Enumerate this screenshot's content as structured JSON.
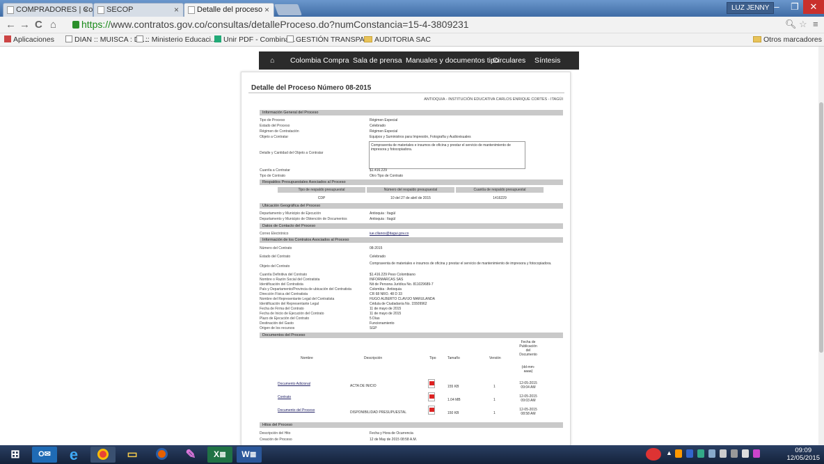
{
  "browser": {
    "tabs": [
      {
        "label": "COMPRADORES | Colomb"
      },
      {
        "label": "SECOP"
      },
      {
        "label": "Detalle del proceso"
      }
    ],
    "user_badge": "LUZ JENNY",
    "url_https": "https://",
    "url_rest": "www.contratos.gov.co/consultas/detalleProceso.do?numConstancia=15-4-3809231",
    "bookmarks": [
      "Aplicaciones",
      "DIAN :: MUISCA : Dil...",
      ":: Ministerio Educaci...",
      "Unir PDF - Combina...",
      "GESTIÓN TRANSPA...",
      "AUDITORIA SAC"
    ],
    "other_bookmarks": "Otros marcadores"
  },
  "site_nav": [
    "Colombia Compra",
    "Sala de prensa",
    "Manuales y documentos tipo",
    "Circulares",
    "Síntesis"
  ],
  "panel": {
    "title": "Detalle del Proceso Número 08-2015",
    "entity": "ANTIOQUIA - INSTITUCIÓN EDUCATIVA CARLOS ENRIQUE CORTES - ITAGÜI",
    "sections": {
      "general": "Información General del Proceso",
      "budget": "Respaldos Presupuestales Asociados al Proceso",
      "location": "Ubicación Geográfica del Proceso",
      "contact": "Datos de Contacto del Proceso",
      "contracts": "Información de los Contratos Asociados al Proceso",
      "documents": "Documentos del Proceso",
      "milestones": "Hitos del Proceso"
    },
    "general_rows": [
      {
        "label": "Tipo de Proceso",
        "value": "Régimen Especial"
      },
      {
        "label": "Estado del Proceso",
        "value": "Celebrado"
      },
      {
        "label": "Régimen de Contratación",
        "value": "Régimen Especial"
      },
      {
        "label": "Objeto a Contratar",
        "value": "Equipos y Suministros para Impresión, Fotografía y Audiovisuales"
      },
      {
        "label": "Detalle y Cantidad del Objeto a Contratar",
        "value": ""
      },
      {
        "label": "Cuantía a Contratar",
        "value": "$1.416.229"
      },
      {
        "label": "Tipo de Contrato",
        "value": "Otro Tipo de Contrato"
      }
    ],
    "detail_text": "Compraventa de materiales e insumos de oficina y prestar el servicio de mantenimiento de impresora y fotocopiadora.",
    "budget_headers": [
      "Tipo de respaldo presupuestal",
      "Número del respaldo presupuestal",
      "Cuantía de respaldo presupuestal"
    ],
    "budget_row": [
      "CDP",
      "10 del 27 de abril de 2015",
      "1416229"
    ],
    "location_rows": [
      {
        "label": "Departamento y Municipio de Ejecución",
        "value": "Antioquia : Itagüí"
      },
      {
        "label": "Departamento y Municipio de Obtención de Documentos",
        "value": "Antioquia : Itagüí"
      }
    ],
    "contact_rows": [
      {
        "label": "Correo Electrónico",
        "value": "iue.cllanos@itagui.gov.co"
      }
    ],
    "contract_rows": [
      {
        "label": "Número del Contrato",
        "value": "08-2015"
      },
      {
        "label": "Estado del Contrato",
        "value": "Celebrado"
      },
      {
        "label": "Objeto del Contrato",
        "value": "Compraventa de materiales e insumos de oficina y prestar el servicio de mantenimiento de impresora y fotocopiadora."
      },
      {
        "label": "Cuantía Definitiva del Contrato",
        "value": "$1.416.229 Peso Colombiano"
      },
      {
        "label": "Nombre o Razón Social del Contratista",
        "value": "INFORMARCAS SAS"
      },
      {
        "label": "Identificación del Contratista",
        "value": "Nit de Persona Jurídica No. 811029689-7"
      },
      {
        "label": "País y Departamento/Provincia de ubicación del Contratista",
        "value": "Colombia : Antioquia"
      },
      {
        "label": "Dirección Física del Contratista",
        "value": "CR 68 NRO. 48 D 33"
      },
      {
        "label": "Nombre del Representante Legal del Contratista",
        "value": "HUGO ALBERTO CLAVIJO MARULANDA"
      },
      {
        "label": "Identificación del Representante Legal",
        "value": "Cédula de Ciudadanía No. 15509962"
      },
      {
        "label": "Fecha de Firma del Contrato",
        "value": "11 de mayo de 2015"
      },
      {
        "label": "Fecha de Inicio de Ejecución del Contrato",
        "value": "11 de mayo de 2015"
      },
      {
        "label": "Plazo de Ejecución del Contrato",
        "value": "5 Días"
      },
      {
        "label": "Destinación del Gasto",
        "value": "Funcionamiento"
      },
      {
        "label": "Origen de los recursos",
        "value": "SGP"
      }
    ],
    "doc_headers": [
      "Nombre",
      "Descripción",
      "Tipo",
      "Tamaño",
      "Versión",
      "Fecha de Publicación del Documento",
      "(dd-mm-aaaa)"
    ],
    "documents": [
      {
        "name": "Documento Adicional",
        "desc": "ACTA DE INICIO",
        "size": "155 KB",
        "version": "1",
        "date": "12-05-2015 09:04 AM"
      },
      {
        "name": "Contrato",
        "desc": "",
        "size": "1.04 MB",
        "version": "1",
        "date": "12-05-2015 09:03 AM"
      },
      {
        "name": "Documento del Proceso",
        "desc": "DISPONIBILIDAD PRESUPUESTAL",
        "size": "150 KB",
        "version": "1",
        "date": "12-05-2015 08:58 AM"
      }
    ],
    "milestone_rows": [
      {
        "label": "Descripción del Hito",
        "value": "Fecha y Hora de Ocurrencia"
      },
      {
        "label": "Creación de Proceso",
        "value": "12 de May de 2015 08:58 A.M."
      }
    ]
  },
  "taskbar": {
    "time": "09:09",
    "date": "12/05/2015"
  }
}
